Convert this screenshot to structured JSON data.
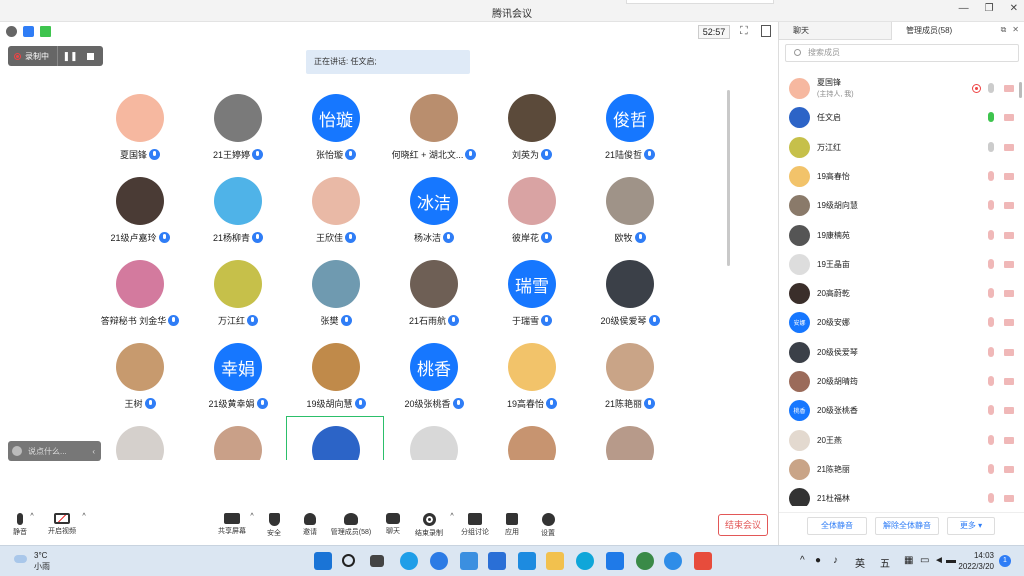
{
  "window": {
    "title": "腾讯会议"
  },
  "meeting": {
    "timer": "52:57",
    "recording_label": "录制中",
    "speaking_label": "正在讲话: 任文启;",
    "chat_placeholder": "说点什么..."
  },
  "participants": [
    {
      "name": "夏国锋",
      "avatar": "photo",
      "color": "#f6b8a0"
    },
    {
      "name": "21王婷婷",
      "avatar": "photo",
      "color": "#7a7a7a"
    },
    {
      "name": "张怡璇",
      "avatar": "怡璇",
      "color": "#1677ff"
    },
    {
      "name": "何晓红 + 湖北文...",
      "avatar": "photo",
      "color": "#b98e6e"
    },
    {
      "name": "刘英为",
      "avatar": "photo",
      "color": "#5b4a3a"
    },
    {
      "name": "21陆俊哲",
      "avatar": "俊哲",
      "color": "#1677ff"
    },
    {
      "name": "21级卢嘉玲",
      "avatar": "photo",
      "color": "#4a3b35"
    },
    {
      "name": "21杨柳青",
      "avatar": "photo",
      "color": "#4fb3e8"
    },
    {
      "name": "王欣佳",
      "avatar": "photo",
      "color": "#e9b9a6"
    },
    {
      "name": "杨冰洁",
      "avatar": "冰洁",
      "color": "#1677ff"
    },
    {
      "name": "彼岸花",
      "avatar": "photo",
      "color": "#d9a3a3"
    },
    {
      "name": "欧牧",
      "avatar": "photo",
      "color": "#9f9388"
    },
    {
      "name": "答辩秘书 刘金华",
      "avatar": "photo",
      "color": "#d37a9e"
    },
    {
      "name": "万江红",
      "avatar": "photo",
      "color": "#c6c04a"
    },
    {
      "name": "张樊",
      "avatar": "photo",
      "color": "#6f9ab0"
    },
    {
      "name": "21石雨航",
      "avatar": "photo",
      "color": "#6e5f55"
    },
    {
      "name": "于瑞雪",
      "avatar": "瑞雪",
      "color": "#1677ff"
    },
    {
      "name": "20级侯爱琴",
      "avatar": "photo",
      "color": "#3b4048"
    },
    {
      "name": "王树",
      "avatar": "photo",
      "color": "#c79a6e"
    },
    {
      "name": "21级黄幸娟",
      "avatar": "幸娟",
      "color": "#1677ff"
    },
    {
      "name": "19级胡向慧",
      "avatar": "photo",
      "color": "#c08a4a"
    },
    {
      "name": "20级张桃香",
      "avatar": "桃香",
      "color": "#1677ff"
    },
    {
      "name": "19高春怡",
      "avatar": "photo",
      "color": "#f2c36a"
    },
    {
      "name": "21陈艳丽",
      "avatar": "photo",
      "color": "#c9a487"
    },
    {
      "name": "",
      "avatar": "photo",
      "color": "#d5d0cc"
    },
    {
      "name": "",
      "avatar": "photo",
      "color": "#c9a088"
    },
    {
      "name": "",
      "avatar": "photo",
      "color": "#2c64c7"
    },
    {
      "name": "",
      "avatar": "photo",
      "color": "#d8d8d8"
    },
    {
      "name": "",
      "avatar": "photo",
      "color": "#c79470"
    },
    {
      "name": "",
      "avatar": "photo",
      "color": "#b79a8a"
    }
  ],
  "toolbar": {
    "mute": "静音",
    "video": "开启视频",
    "share": "共享屏幕",
    "security": "安全",
    "invite": "邀请",
    "members": "管理成员(58)",
    "chat": "聊天",
    "end_record": "结束录制",
    "breakout": "分组讨论",
    "apps": "应用",
    "settings": "设置",
    "end_meeting": "结束会议"
  },
  "panel": {
    "tab_chat": "聊天",
    "tab_members": "管理成员(58)",
    "search_placeholder": "搜索成员",
    "members": [
      {
        "name": "夏国锋",
        "sub": "(主持人, 我)",
        "color": "#f6b8a0",
        "avatar": "",
        "mic": "gray",
        "rec": true
      },
      {
        "name": "任文启",
        "sub": "",
        "color": "#2c64c7",
        "avatar": "",
        "mic": "on",
        "rec": false
      },
      {
        "name": "万江红",
        "sub": "",
        "color": "#c6c04a",
        "avatar": "",
        "mic": "gray",
        "rec": false
      },
      {
        "name": "19高春怡",
        "sub": "",
        "color": "#f2c36a",
        "avatar": "",
        "mic": "muted",
        "rec": false
      },
      {
        "name": "19级胡向慧",
        "sub": "",
        "color": "#8a7a6a",
        "avatar": "",
        "mic": "muted",
        "rec": false
      },
      {
        "name": "19康楠苑",
        "sub": "",
        "color": "#555555",
        "avatar": "",
        "mic": "muted",
        "rec": false
      },
      {
        "name": "19王晶亩",
        "sub": "",
        "color": "#dddddd",
        "avatar": "",
        "mic": "muted",
        "rec": false
      },
      {
        "name": "20高蔚乾",
        "sub": "",
        "color": "#3a2e2a",
        "avatar": "",
        "mic": "muted",
        "rec": false
      },
      {
        "name": "20级安娜",
        "sub": "",
        "color": "#1677ff",
        "avatar": "安娜",
        "mic": "muted",
        "rec": false
      },
      {
        "name": "20级侯爱琴",
        "sub": "",
        "color": "#3b4048",
        "avatar": "",
        "mic": "muted",
        "rec": false
      },
      {
        "name": "20级胡晴筠",
        "sub": "",
        "color": "#9b6b5a",
        "avatar": "",
        "mic": "muted",
        "rec": false
      },
      {
        "name": "20级张桃香",
        "sub": "",
        "color": "#1677ff",
        "avatar": "桃香",
        "mic": "muted",
        "rec": false
      },
      {
        "name": "20王燕",
        "sub": "",
        "color": "#e3d9cf",
        "avatar": "",
        "mic": "muted",
        "rec": false
      },
      {
        "name": "21陈艳丽",
        "sub": "",
        "color": "#c9a487",
        "avatar": "",
        "mic": "muted",
        "rec": false
      },
      {
        "name": "21杜福林",
        "sub": "",
        "color": "#333333",
        "avatar": "",
        "mic": "muted",
        "rec": false
      }
    ],
    "btn_mute_all": "全体静音",
    "btn_unmute_all": "解除全体静音",
    "btn_more": "更多 ▾"
  },
  "taskbar": {
    "temp": "3°C",
    "weather": "小雨",
    "ime1": "英",
    "ime2": "五",
    "time": "14:03",
    "date": "2022/3/20",
    "notif": "1"
  }
}
